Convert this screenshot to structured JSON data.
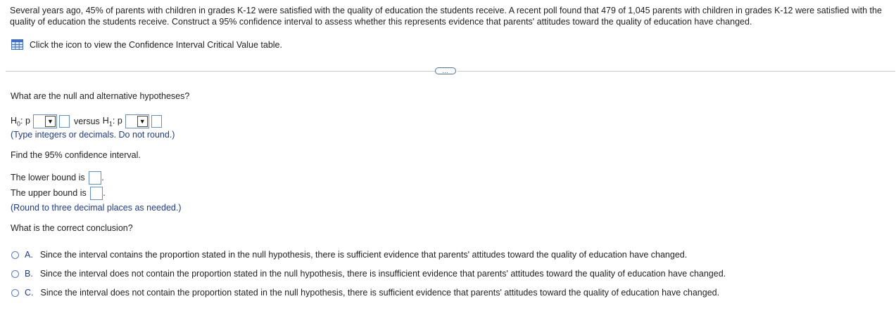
{
  "question": {
    "intro": "Several years ago, 45% of parents with children in grades K-12 were satisfied with the quality of education the students receive. A recent poll found that 479 of 1,045 parents with children in grades K-12 were satisfied with the quality of education the students receive. Construct a 95% confidence interval to assess whether this represents evidence that parents' attitudes toward the quality of education have changed.",
    "table_link": "Click the icon to view the Confidence Interval Critical Value table.",
    "more_button": "…"
  },
  "hypotheses": {
    "prompt": "What are the null and alternative hypotheses?",
    "h0_symbol": "H",
    "h0_sub": "0",
    "h1_symbol": "H",
    "h1_sub": "1",
    "param": "p",
    "colon": ":",
    "versus": "versus",
    "h0_dropdown_value": "",
    "h0_value": "",
    "h1_dropdown_value": "",
    "h1_value": "",
    "hint": "(Type integers or decimals. Do not round.)"
  },
  "interval": {
    "prompt": "Find the 95% confidence interval.",
    "lower_label": "The lower bound is",
    "upper_label": "The upper bound is",
    "lower_value": "",
    "upper_value": "",
    "period": ".",
    "hint": "(Round to three decimal places as needed.)"
  },
  "conclusion": {
    "prompt": "What is the correct conclusion?",
    "options": [
      {
        "letter": "A.",
        "text": "Since the interval contains the proportion stated in the null hypothesis, there is sufficient evidence that parents' attitudes toward the quality of education have changed."
      },
      {
        "letter": "B.",
        "text": "Since the interval does not contain the proportion stated in the null hypothesis, there is insufficient evidence that parents' attitudes toward the quality of education have changed."
      },
      {
        "letter": "C.",
        "text": "Since the interval does not contain the proportion stated in the null hypothesis, there is sufficient evidence that parents' attitudes toward the quality of education have changed."
      }
    ]
  },
  "colors": {
    "hint_text": "#1d3c8f",
    "input_border": "#5b8fd6",
    "divider": "#c8c8c8",
    "table_icon": "#3a6fc4"
  },
  "icons": {
    "table": "table-grid-icon",
    "dropdown_arrow": "triangle-down-icon"
  }
}
